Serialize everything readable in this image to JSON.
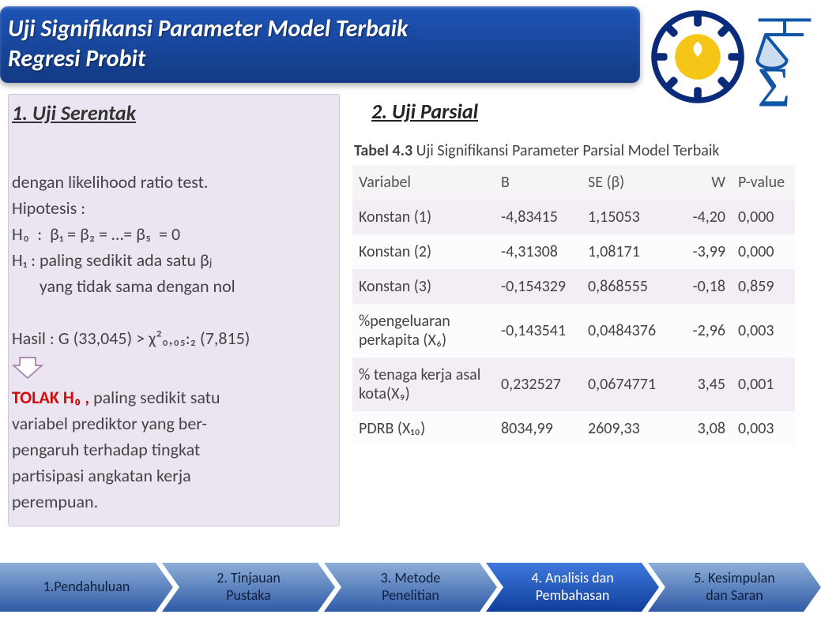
{
  "banner": {
    "title_line1": "Uji Signifikansi Parameter Model Terbaik",
    "title_line2": "Regresi Probit"
  },
  "left": {
    "heading": "1.  Uji Serentak",
    "line_intro": "dengan likelihood ratio test.",
    "line_hipotesis": "Hipotesis :",
    "line_h0": "H₀  :  β₁ = β₂ = …= β₅  = 0",
    "line_h1a": "H₁ : paling sedikit ada satu βⱼ",
    "line_h1b": "       yang tidak sama dengan nol",
    "line_hasil": "Hasil : G (33,045) > χ²₀,₀₅:₂ (7,815)",
    "tolak": "TOLAK H₀ ,",
    "conclusion": " paling sedikit satu\nvariabel prediktor yang ber-\npengaruh terhadap tingkat\npartisipasi angkatan kerja\nperempuan."
  },
  "right": {
    "heading": "2. Uji Parsial",
    "caption_bold": "Tabel 4.3",
    "caption_rest": " Uji Signifikansi Parameter Parsial Model Terbaik",
    "headers": [
      "Variabel",
      "B",
      "SE (β)",
      "W",
      "P-value"
    ],
    "rows": [
      {
        "v": "Konstan (1)",
        "b": "-4,83415",
        "se": "1,15053",
        "w": "-4,20",
        "p": "0,000"
      },
      {
        "v": "Konstan (2)",
        "b": "-4,31308",
        "se": "1,08171",
        "w": "-3,99",
        "p": "0,000"
      },
      {
        "v": "Konstan (3)",
        "b": "-0,154329",
        "se": "0,868555",
        "w": "-0,18",
        "p": "0,859"
      },
      {
        "v": "%pengeluaran perkapita (X₆)",
        "b": "-0,143541",
        "se": "0,0484376",
        "w": "-2,96",
        "p": "0,003"
      },
      {
        "v": "% tenaga kerja asal kota(X₉)",
        "b": "0,232527",
        "se": "0,0674771",
        "w": "3,45",
        "p": "0,001"
      },
      {
        "v": "PDRB  (X₁₀)",
        "b": "8034,99",
        "se": "2609,33",
        "w": "3,08",
        "p": "0,003"
      }
    ]
  },
  "nav": {
    "steps": [
      {
        "label": "1.Pendahuluan",
        "active": false
      },
      {
        "label": "2. Tinjauan\nPustaka",
        "active": false
      },
      {
        "label": "3. Metode\nPenelitian",
        "active": false
      },
      {
        "label": "4. Analisis dan\nPembahasan",
        "active": true
      },
      {
        "label": "5. Kesimpulan\ndan Saran",
        "active": false
      }
    ]
  }
}
